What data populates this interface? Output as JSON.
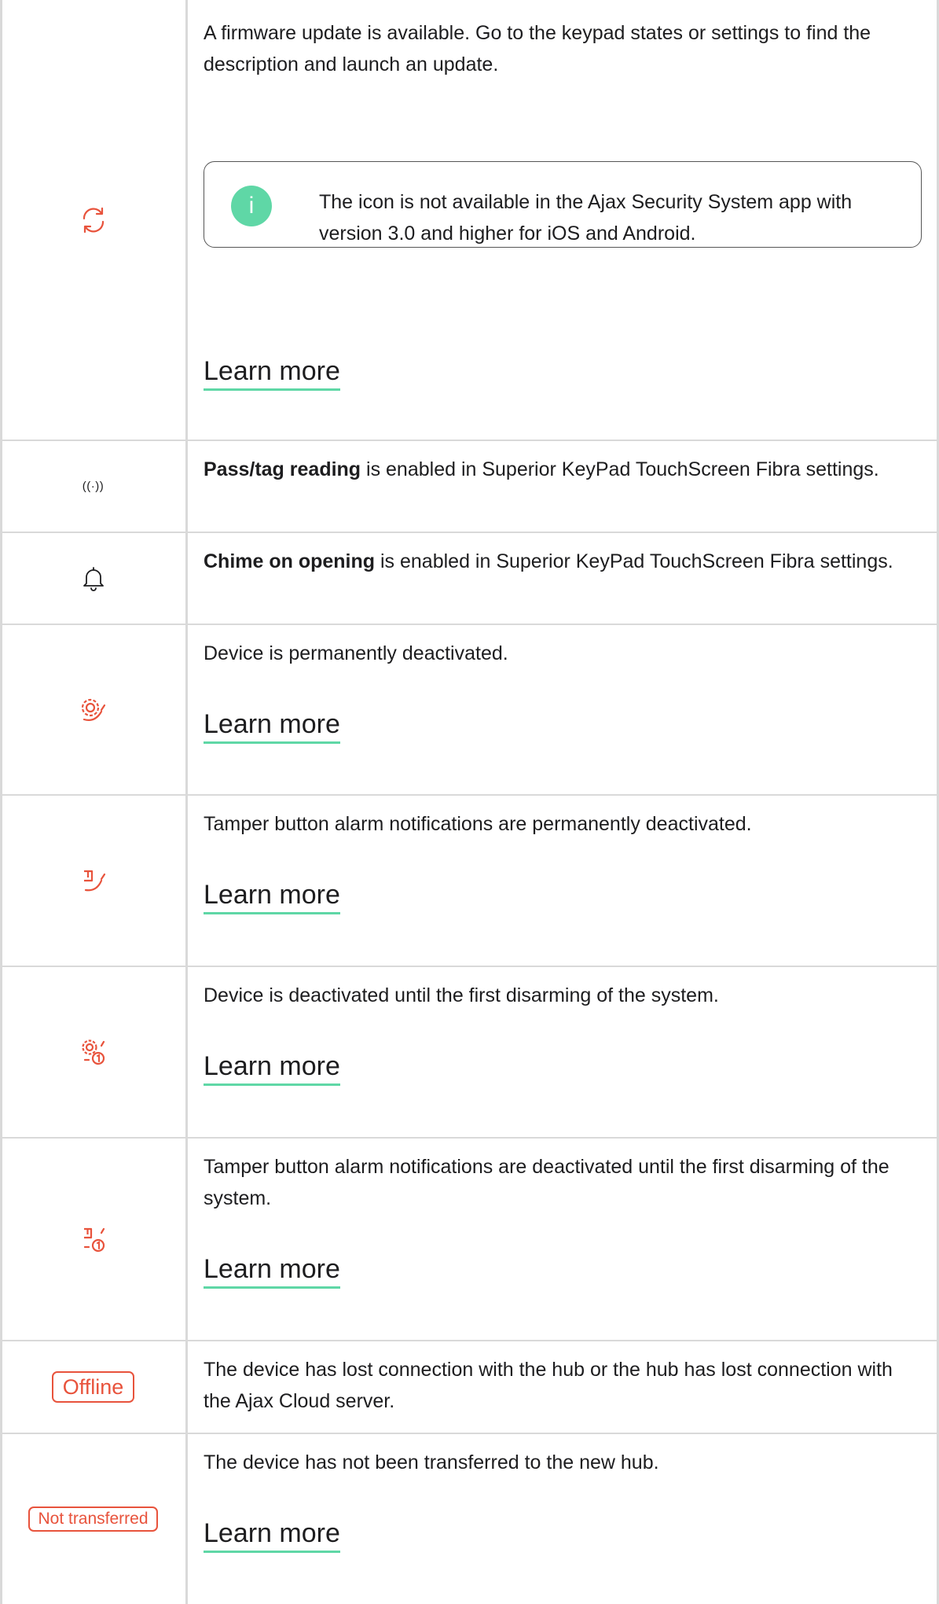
{
  "rows": [
    {
      "icon": "refresh-icon",
      "text": "A firmware update is available. Go to the keypad states or settings to find the description and launch an update.",
      "note": "The icon is not available in the Ajax Security System app with version 3.0 and higher for iOS and Android.",
      "note_badge": "i",
      "link": "Learn more"
    },
    {
      "icon": "pass-reading-icon",
      "icon_text": "((·))",
      "bold": "Pass/tag reading",
      "text": " is enabled in Superior KeyPad TouchScreen Fibra settings."
    },
    {
      "icon": "bell-icon",
      "bold": "Chime on opening",
      "text": " is enabled in Superior KeyPad TouchScreen Fibra settings."
    },
    {
      "icon": "gear-deactivated-icon",
      "text": "Device is permanently deactivated.",
      "link": "Learn more"
    },
    {
      "icon": "tamper-deactivated-icon",
      "text": "Tamper button alarm notifications are permanently deactivated.",
      "link": "Learn more"
    },
    {
      "icon": "gear-until-disarm-icon",
      "text": "Device is deactivated until the first disarming of the system.",
      "link": "Learn more"
    },
    {
      "icon": "tamper-until-disarm-icon",
      "text": "Tamper button alarm notifications are deactivated until the first disarming of the system.",
      "link": "Learn more"
    },
    {
      "icon": "offline-badge",
      "badge": "Offline",
      "text": "The device has lost connection with the hub or the hub has lost connection with the Ajax Cloud server."
    },
    {
      "icon": "not-transferred-badge",
      "badge": "Not transferred",
      "text": "The device has not been transferred to the new hub.",
      "link": "Learn more"
    }
  ],
  "colors": {
    "accent_red": "#e8533c",
    "link_underline": "#5fd7a6",
    "badge_green": "#5fd7a6",
    "border": "#d9d9d9"
  }
}
